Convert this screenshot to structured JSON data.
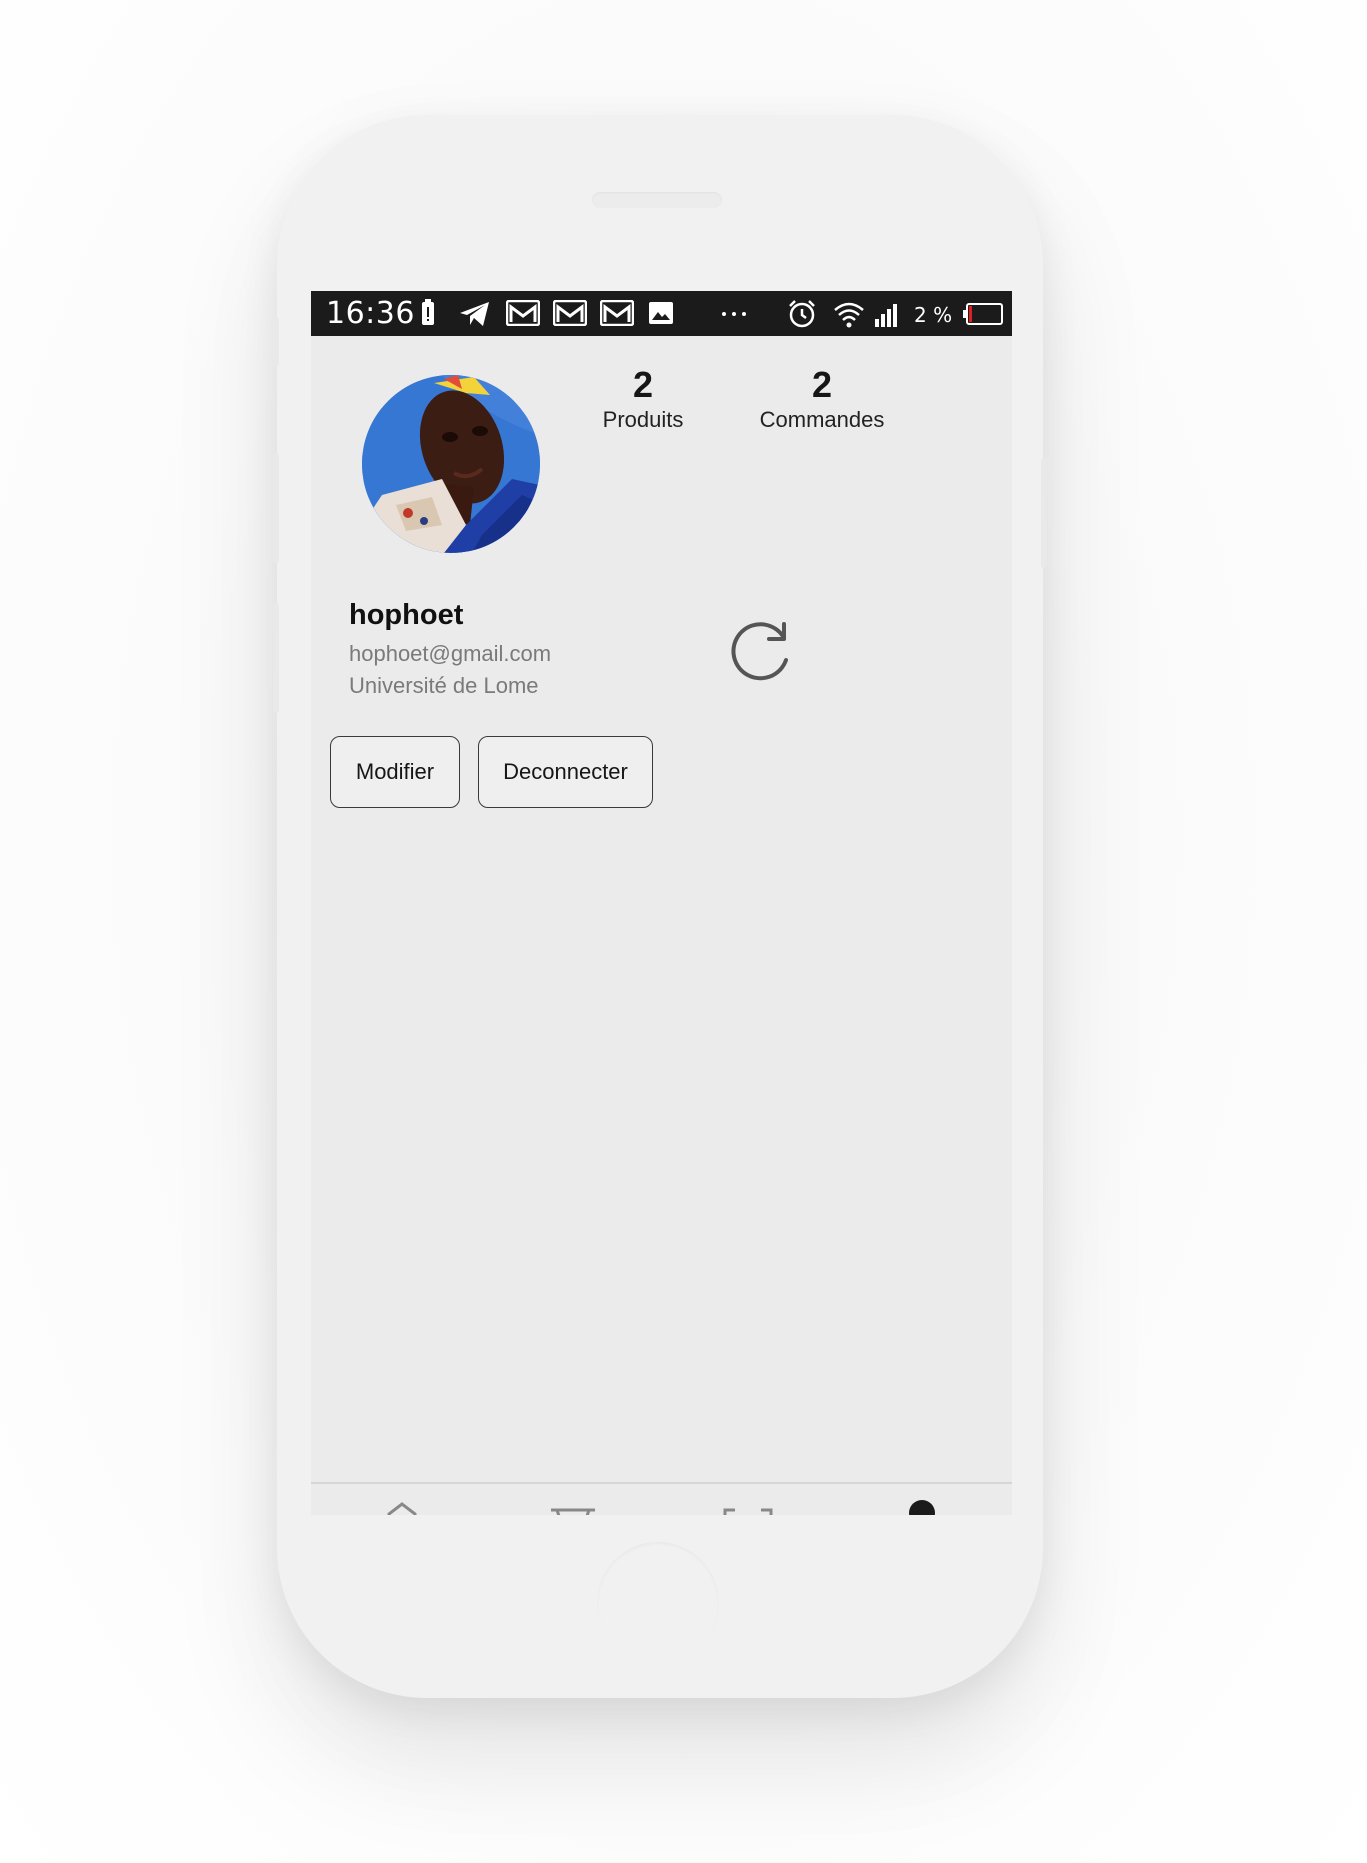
{
  "status_bar": {
    "time": "16:36",
    "battery_percent": "2 %",
    "icons": [
      "battery-alert-icon",
      "telegram-icon",
      "gmail-icon",
      "gmail-icon",
      "gmail-icon",
      "image-icon",
      "more-dots-icon",
      "alarm-icon",
      "wifi-icon",
      "signal-icon",
      "battery-icon"
    ]
  },
  "profile": {
    "stats": [
      {
        "value": "2",
        "label": "Produits"
      },
      {
        "value": "2",
        "label": "Commandes"
      }
    ],
    "name": "hophoet",
    "email": "hophoet@gmail.com",
    "school": "Université de Lome"
  },
  "actions": {
    "edit_label": "Modifier",
    "logout_label": "Deconnecter"
  },
  "bottom_nav": {
    "items": [
      "home-icon",
      "cart-icon",
      "scan-icon",
      "profile-icon"
    ]
  },
  "colors": {
    "status_bar": "#1b1b1b",
    "screen_bg": "#ebebeb",
    "avatar_bg": "#2f6fcd"
  }
}
